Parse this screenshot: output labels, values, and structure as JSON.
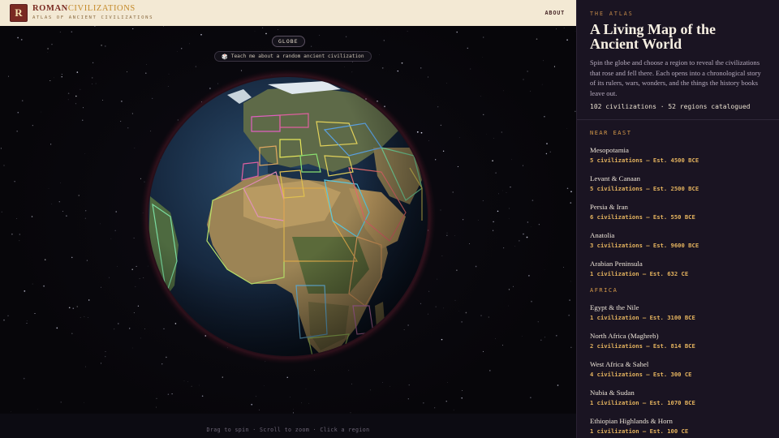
{
  "header": {
    "logo_letter": "R",
    "brand_a": "ROMAN",
    "brand_b": "CIVILIZATIONS",
    "brand_sub": "ATLAS OF ANCIENT CIVILIZATIONS",
    "about": "ABOUT"
  },
  "stage": {
    "view_label": "GLOBE",
    "teach_icon": "🎲",
    "teach_label": "Teach me about a random ancient civilization",
    "hint": "Drag to spin · Scroll to zoom · Click a region"
  },
  "sidebar": {
    "eyebrow": "THE ATLAS",
    "title": "A Living Map of the Ancient World",
    "description": "Spin the globe and choose a region to reveal the civilizations that rose and fell there. Each opens into a chronological story of its rulers, wars, wonders, and the things the history books leave out.",
    "stats": "102 civilizations · 52 regions catalogued",
    "sections": [
      {
        "title": "NEAR EAST",
        "regions": [
          {
            "name": "Mesopotamia",
            "meta": "5 civilizations — Est. 4500 BCE"
          },
          {
            "name": "Levant & Canaan",
            "meta": "5 civilizations — Est. 2500 BCE"
          },
          {
            "name": "Persia & Iran",
            "meta": "6 civilizations — Est. 550 BCE"
          },
          {
            "name": "Anatolia",
            "meta": "3 civilizations — Est. 9600 BCE"
          },
          {
            "name": "Arabian Peninsula",
            "meta": "1 civilization — Est. 632 CE"
          }
        ]
      },
      {
        "title": "AFRICA",
        "regions": [
          {
            "name": "Egypt & the Nile",
            "meta": "1 civilization — Est. 3100 BCE"
          },
          {
            "name": "North Africa (Maghreb)",
            "meta": "2 civilizations — Est. 814 BCE"
          },
          {
            "name": "West Africa & Sahel",
            "meta": "4 civilizations — Est. 300 CE"
          },
          {
            "name": "Nubia & Sudan",
            "meta": "1 civilization — Est. 1070 BCE"
          },
          {
            "name": "Ethiopian Highlands & Horn",
            "meta": "1 civilization — Est. 100 CE"
          }
        ]
      }
    ]
  },
  "colors": {
    "header_bg": "#f3e9d4",
    "brand_red": "#7a2a22",
    "brand_gold": "#c48a2a",
    "sidebar_bg": "#1a1422",
    "accent_gold": "#e3b25e",
    "section_orange": "#d69a4a"
  }
}
